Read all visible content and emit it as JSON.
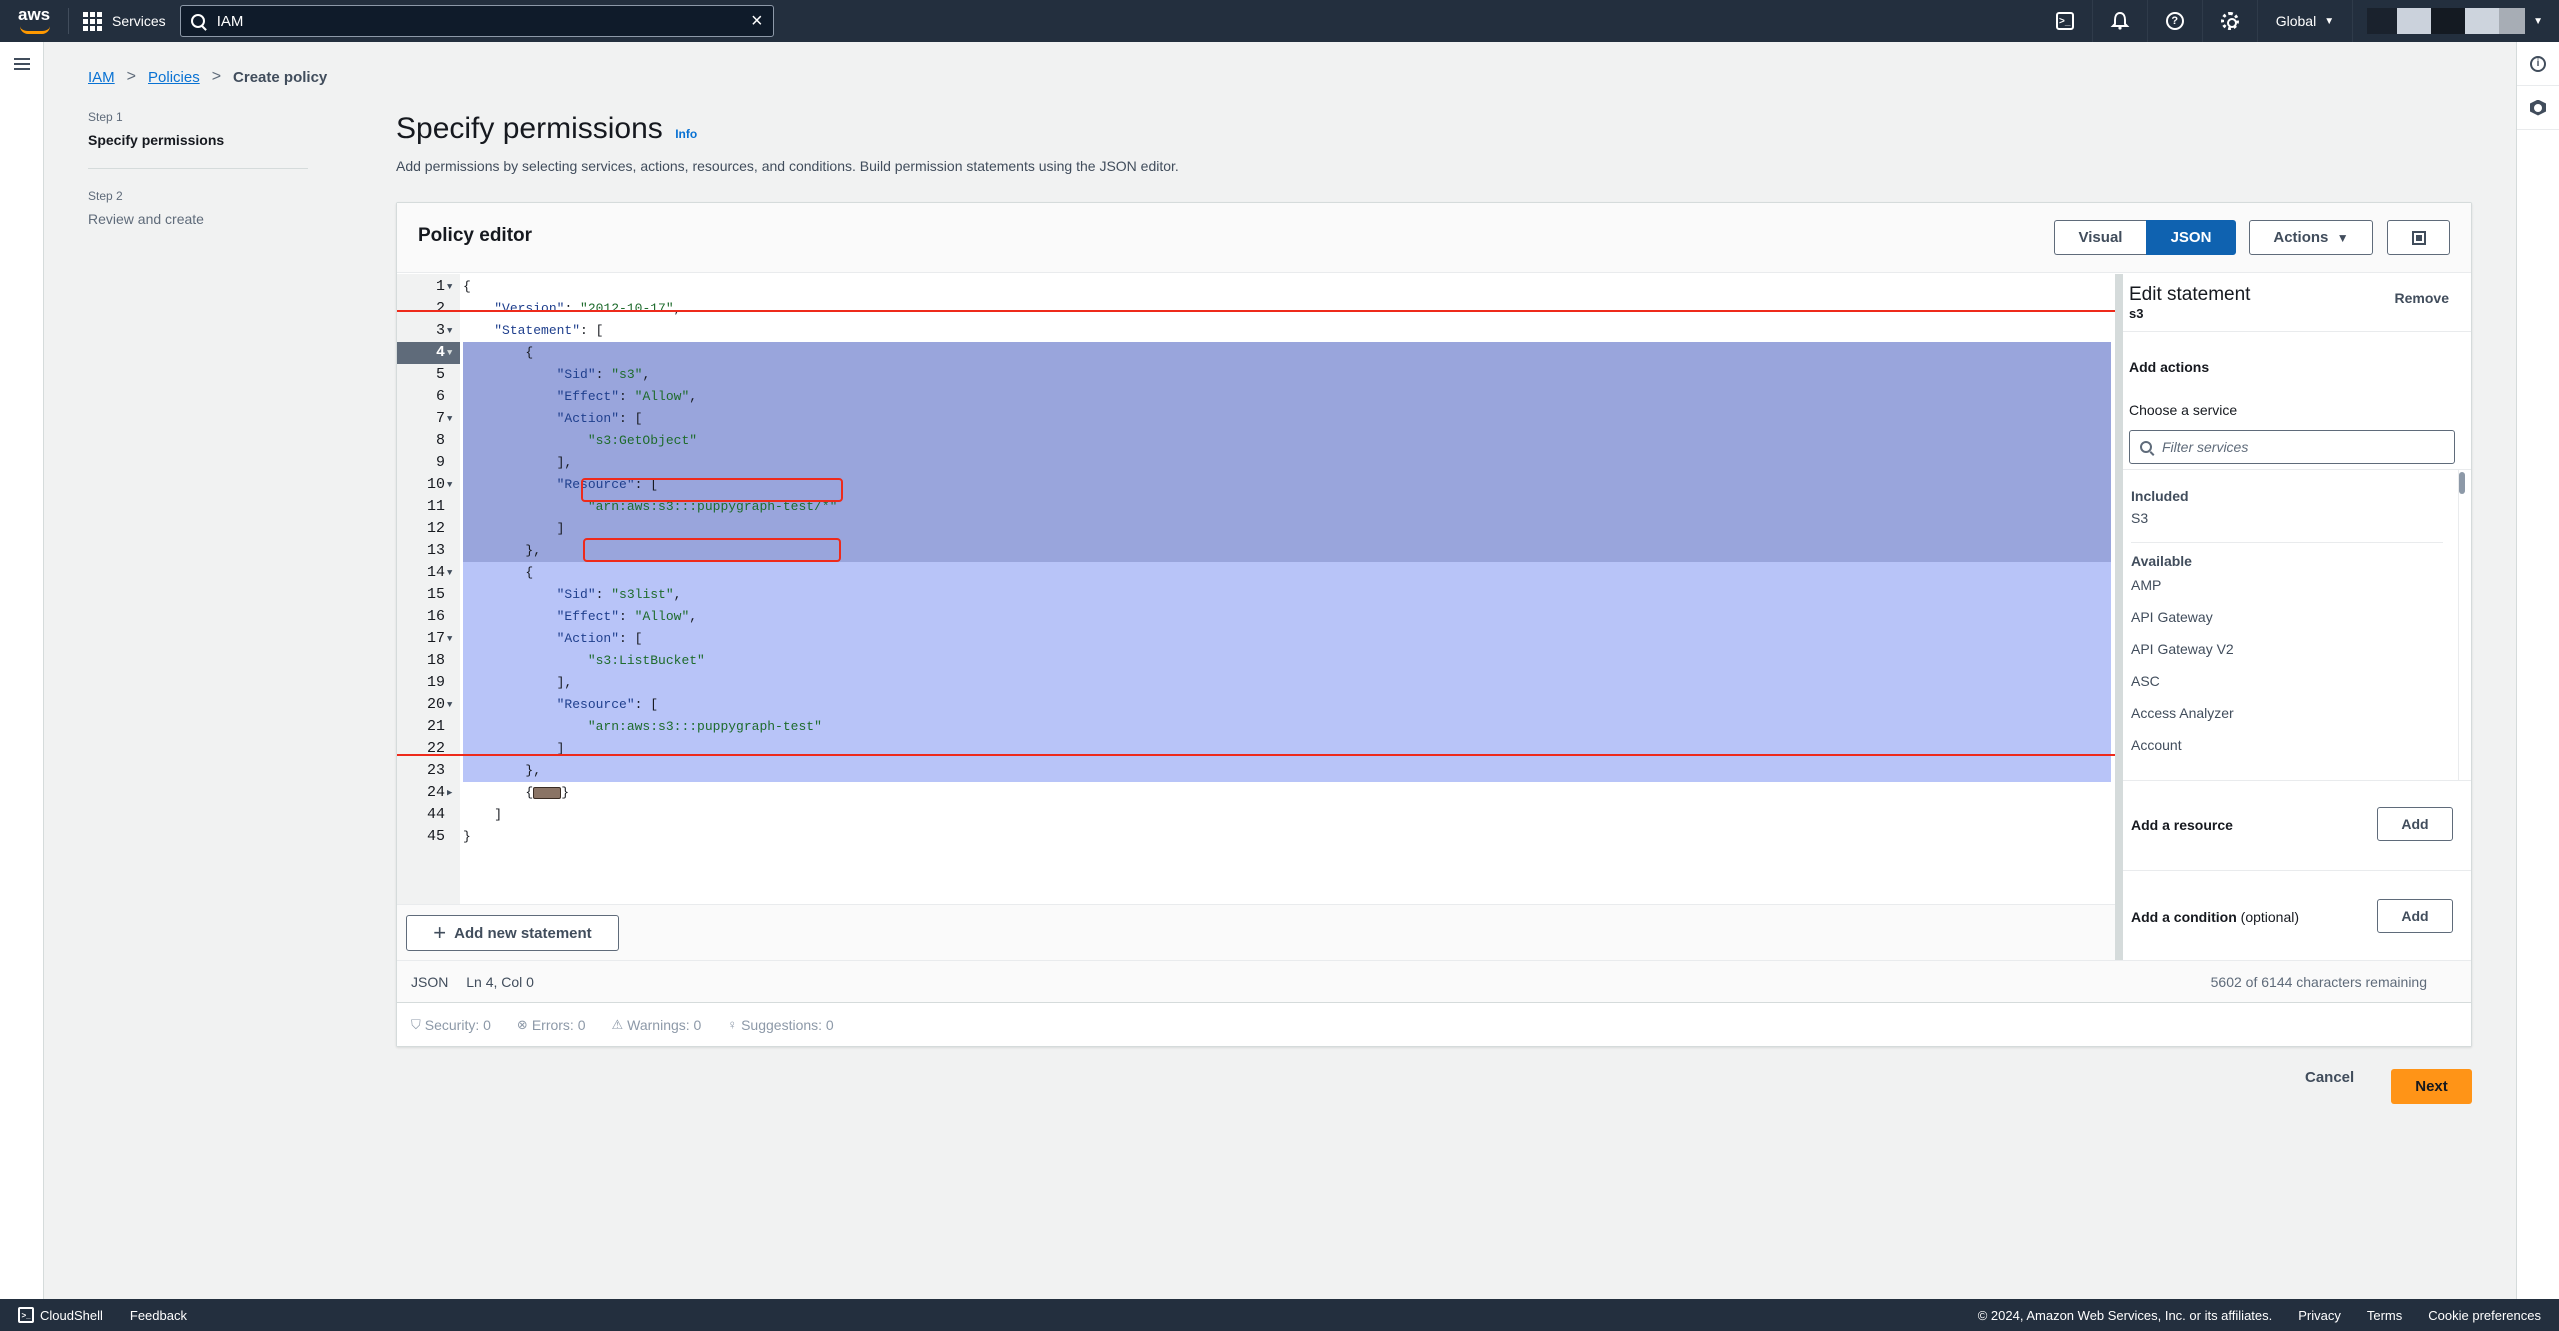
{
  "topnav": {
    "logo": "aws",
    "services_label": "Services",
    "search_value": "IAM",
    "clear_icon": "×",
    "region": "Global"
  },
  "breadcrumb": [
    {
      "label": "IAM",
      "link": true
    },
    {
      "label": "Policies",
      "link": true
    },
    {
      "label": "Create policy",
      "link": false
    }
  ],
  "steps": [
    {
      "label": "Step 1",
      "title": "Specify permissions",
      "active": true
    },
    {
      "label": "Step 2",
      "title": "Review and create",
      "active": false
    }
  ],
  "header": {
    "title": "Specify permissions",
    "info": "Info",
    "description": "Add permissions by selecting services, actions, resources, and conditions. Build permission statements using the JSON editor."
  },
  "editor": {
    "title": "Policy editor",
    "mode_visual": "Visual",
    "mode_json": "JSON",
    "active_mode": "JSON",
    "actions_label": "Actions",
    "caret": "▼",
    "add_statement_label": "Add new statement",
    "status_lang": "JSON",
    "status_pos": "Ln 4, Col 0",
    "chars_remaining": "5602 of 6144 characters remaining",
    "validation": {
      "security": "Security: 0",
      "errors": "Errors: 0",
      "warnings": "Warnings: 0",
      "suggestions": "Suggestions: 0"
    },
    "lines": [
      {
        "n": "1",
        "fold": "▼",
        "text": "{"
      },
      {
        "n": "2",
        "fold": "",
        "text": "    \"Version\": \"2012-10-17\","
      },
      {
        "n": "3",
        "fold": "▼",
        "text": "    \"Statement\": ["
      },
      {
        "n": "4",
        "fold": "▼",
        "text": "        {"
      },
      {
        "n": "5",
        "fold": "",
        "text": "            \"Sid\": \"s3\","
      },
      {
        "n": "6",
        "fold": "",
        "text": "            \"Effect\": \"Allow\","
      },
      {
        "n": "7",
        "fold": "▼",
        "text": "            \"Action\": ["
      },
      {
        "n": "8",
        "fold": "",
        "text": "                \"s3:GetObject\""
      },
      {
        "n": "9",
        "fold": "",
        "text": "            ],"
      },
      {
        "n": "10",
        "fold": "▼",
        "text": "            \"Resource\": ["
      },
      {
        "n": "11",
        "fold": "",
        "text": "                \"arn:aws:s3:::puppygraph-test/*\""
      },
      {
        "n": "12",
        "fold": "",
        "text": "            ]"
      },
      {
        "n": "13",
        "fold": "",
        "text": "        },"
      },
      {
        "n": "14",
        "fold": "▼",
        "text": "        {"
      },
      {
        "n": "15",
        "fold": "",
        "text": "            \"Sid\": \"s3list\","
      },
      {
        "n": "16",
        "fold": "",
        "text": "            \"Effect\": \"Allow\","
      },
      {
        "n": "17",
        "fold": "▼",
        "text": "            \"Action\": ["
      },
      {
        "n": "18",
        "fold": "",
        "text": "                \"s3:ListBucket\""
      },
      {
        "n": "19",
        "fold": "",
        "text": "            ],"
      },
      {
        "n": "20",
        "fold": "▼",
        "text": "            \"Resource\": ["
      },
      {
        "n": "21",
        "fold": "",
        "text": "                \"arn:aws:s3:::puppygraph-test\""
      },
      {
        "n": "22",
        "fold": "",
        "text": "            ]"
      },
      {
        "n": "23",
        "fold": "",
        "text": "        },"
      },
      {
        "n": "24",
        "fold": "▶",
        "text": "        {⟷}"
      },
      {
        "n": "44",
        "fold": "",
        "text": "    ]"
      },
      {
        "n": "45",
        "fold": "",
        "text": "}"
      }
    ]
  },
  "panel": {
    "title": "Edit statement",
    "subtitle": "s3",
    "remove_label": "Remove",
    "add_actions": "Add actions",
    "choose_service": "Choose a service",
    "filter_placeholder": "Filter services",
    "included_label": "Included",
    "included": [
      "S3"
    ],
    "available_label": "Available",
    "available": [
      "AMP",
      "API Gateway",
      "API Gateway V2",
      "ASC",
      "Access Analyzer",
      "Account"
    ],
    "add_resource": "Add a resource",
    "add_condition": "Add a condition",
    "optional": "(optional)",
    "add_button": "Add"
  },
  "footer_actions": {
    "cancel": "Cancel",
    "next": "Next"
  },
  "bottombar": {
    "cloudshell": "CloudShell",
    "feedback": "Feedback",
    "copyright": "© 2024, Amazon Web Services, Inc. or its affiliates.",
    "privacy": "Privacy",
    "terms": "Terms",
    "cookies": "Cookie preferences"
  },
  "colors": {
    "nav_bg": "#232f3e",
    "primary_blue": "#0f62b0",
    "link_blue": "#0972d3",
    "next_orange": "#ff9417",
    "annotation_red": "#ee2a1b",
    "selection_dark": "#99a5dc",
    "selection_light": "#b8c4f8"
  }
}
